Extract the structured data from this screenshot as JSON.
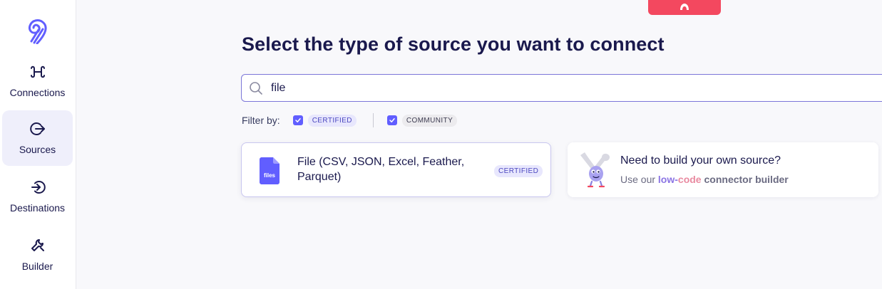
{
  "sidebar": {
    "items": [
      {
        "label": "Connections",
        "icon": "connections-icon",
        "active": false
      },
      {
        "label": "Sources",
        "icon": "sources-icon",
        "active": true
      },
      {
        "label": "Destinations",
        "icon": "destinations-icon",
        "active": false
      },
      {
        "label": "Builder",
        "icon": "builder-icon",
        "active": false
      }
    ]
  },
  "header": {
    "title": "Select the type of source you want to connect"
  },
  "search": {
    "value": "file",
    "icon": "search-icon"
  },
  "filters": {
    "label": "Filter by:",
    "options": [
      {
        "label": "CERTIFIED",
        "checked": true
      },
      {
        "label": "COMMUNITY",
        "checked": true
      }
    ]
  },
  "results": [
    {
      "name": "File (CSV, JSON, Excel, Feather, Parquet)",
      "badge": "CERTIFIED",
      "icon_label": "files"
    }
  ],
  "builder_card": {
    "headline": "Need to build your own source?",
    "prefix": "Use our ",
    "low": "low-",
    "code": "code",
    "suffix": " connector builder"
  },
  "colors": {
    "accent": "#615eff",
    "title": "#1a194d",
    "top_tab": "#f3485f"
  }
}
